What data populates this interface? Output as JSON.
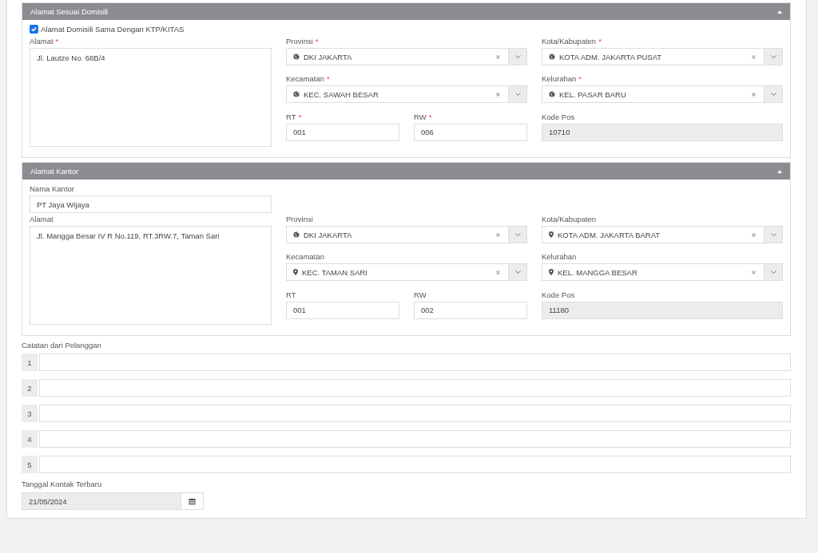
{
  "sections": [
    {
      "title": "Alamat Sesuai Domisili",
      "expanded": true,
      "checkbox": {
        "label": "Alamat Domisili Sama Dengan KTP/KITAS",
        "checked": true
      },
      "address": {
        "label": "Alamat",
        "mark": "*",
        "value": "Jl. Lautze No. 68B/4"
      },
      "fields": [
        {
          "kind": "globe-select",
          "label": "Provinsi",
          "mark": "*",
          "value": "DKI JAKARTA"
        },
        {
          "kind": "globe-select",
          "label": "Kota/Kabupaten",
          "mark": "*",
          "value": "KOTA ADM. JAKARTA PUSAT"
        },
        {
          "kind": "globe-select",
          "label": "Kecamatan",
          "mark": "*",
          "value": "KEC. SAWAH BESAR"
        },
        {
          "kind": "globe-select",
          "label": "Kelurahan",
          "mark": "*",
          "value": "KEL. PASAR BARU"
        },
        {
          "kind": "text",
          "label": "RT",
          "mark": "*",
          "value": "001"
        },
        {
          "kind": "text",
          "label": "RW",
          "mark": "*",
          "value": "006"
        },
        {
          "kind": "readonly",
          "label": "Kode Pos",
          "value": "10710"
        }
      ]
    },
    {
      "title": "Alamat Kantor",
      "expanded": true,
      "office_name": {
        "label": "Nama Kantor",
        "value": "PT Jaya Wijaya"
      },
      "address": {
        "label": "Alamat",
        "value": "Jl. Mangga Besar IV R No.119, RT.3RW.7, Taman Sari"
      },
      "fields": [
        {
          "kind": "globe-select",
          "label": "Provinsi",
          "value": "DKI JAKARTA"
        },
        {
          "kind": "pin-select",
          "label": "Kota/Kabupaten",
          "value": "KOTA ADM. JAKARTA BARAT"
        },
        {
          "kind": "pin-select",
          "label": "Kecamatan",
          "value": "KEC. TAMAN SARI"
        },
        {
          "kind": "pin-select",
          "label": "Kelurahan",
          "value": "KEL. MANGGA BESAR"
        },
        {
          "kind": "text",
          "label": "RT",
          "value": "001"
        },
        {
          "kind": "text",
          "label": "RW",
          "value": "002"
        },
        {
          "kind": "readonly",
          "label": "Kode Pos",
          "value": "11180"
        }
      ]
    }
  ],
  "notes": {
    "label": "Catatan dari Pelanggan",
    "rows": [
      "1",
      "2",
      "3",
      "4",
      "5"
    ]
  },
  "last_contact": {
    "label": "Tanggal Kontak Terbaru",
    "value": "21/05/2024"
  }
}
